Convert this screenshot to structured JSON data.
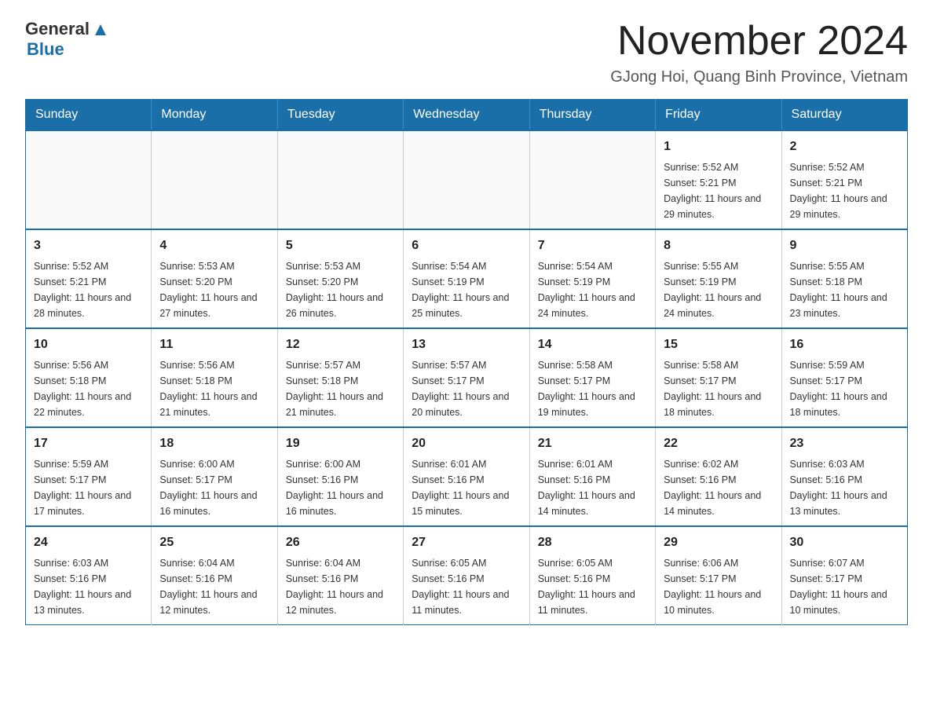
{
  "header": {
    "logo": {
      "general": "General",
      "triangle_alt": "triangle",
      "blue": "Blue"
    },
    "title": "November 2024",
    "subtitle": "GJong Hoi, Quang Binh Province, Vietnam"
  },
  "calendar": {
    "days_of_week": [
      "Sunday",
      "Monday",
      "Tuesday",
      "Wednesday",
      "Thursday",
      "Friday",
      "Saturday"
    ],
    "weeks": [
      [
        {
          "day": "",
          "sunrise": "",
          "sunset": "",
          "daylight": ""
        },
        {
          "day": "",
          "sunrise": "",
          "sunset": "",
          "daylight": ""
        },
        {
          "day": "",
          "sunrise": "",
          "sunset": "",
          "daylight": ""
        },
        {
          "day": "",
          "sunrise": "",
          "sunset": "",
          "daylight": ""
        },
        {
          "day": "",
          "sunrise": "",
          "sunset": "",
          "daylight": ""
        },
        {
          "day": "1",
          "sunrise": "Sunrise: 5:52 AM",
          "sunset": "Sunset: 5:21 PM",
          "daylight": "Daylight: 11 hours and 29 minutes."
        },
        {
          "day": "2",
          "sunrise": "Sunrise: 5:52 AM",
          "sunset": "Sunset: 5:21 PM",
          "daylight": "Daylight: 11 hours and 29 minutes."
        }
      ],
      [
        {
          "day": "3",
          "sunrise": "Sunrise: 5:52 AM",
          "sunset": "Sunset: 5:21 PM",
          "daylight": "Daylight: 11 hours and 28 minutes."
        },
        {
          "day": "4",
          "sunrise": "Sunrise: 5:53 AM",
          "sunset": "Sunset: 5:20 PM",
          "daylight": "Daylight: 11 hours and 27 minutes."
        },
        {
          "day": "5",
          "sunrise": "Sunrise: 5:53 AM",
          "sunset": "Sunset: 5:20 PM",
          "daylight": "Daylight: 11 hours and 26 minutes."
        },
        {
          "day": "6",
          "sunrise": "Sunrise: 5:54 AM",
          "sunset": "Sunset: 5:19 PM",
          "daylight": "Daylight: 11 hours and 25 minutes."
        },
        {
          "day": "7",
          "sunrise": "Sunrise: 5:54 AM",
          "sunset": "Sunset: 5:19 PM",
          "daylight": "Daylight: 11 hours and 24 minutes."
        },
        {
          "day": "8",
          "sunrise": "Sunrise: 5:55 AM",
          "sunset": "Sunset: 5:19 PM",
          "daylight": "Daylight: 11 hours and 24 minutes."
        },
        {
          "day": "9",
          "sunrise": "Sunrise: 5:55 AM",
          "sunset": "Sunset: 5:18 PM",
          "daylight": "Daylight: 11 hours and 23 minutes."
        }
      ],
      [
        {
          "day": "10",
          "sunrise": "Sunrise: 5:56 AM",
          "sunset": "Sunset: 5:18 PM",
          "daylight": "Daylight: 11 hours and 22 minutes."
        },
        {
          "day": "11",
          "sunrise": "Sunrise: 5:56 AM",
          "sunset": "Sunset: 5:18 PM",
          "daylight": "Daylight: 11 hours and 21 minutes."
        },
        {
          "day": "12",
          "sunrise": "Sunrise: 5:57 AM",
          "sunset": "Sunset: 5:18 PM",
          "daylight": "Daylight: 11 hours and 21 minutes."
        },
        {
          "day": "13",
          "sunrise": "Sunrise: 5:57 AM",
          "sunset": "Sunset: 5:17 PM",
          "daylight": "Daylight: 11 hours and 20 minutes."
        },
        {
          "day": "14",
          "sunrise": "Sunrise: 5:58 AM",
          "sunset": "Sunset: 5:17 PM",
          "daylight": "Daylight: 11 hours and 19 minutes."
        },
        {
          "day": "15",
          "sunrise": "Sunrise: 5:58 AM",
          "sunset": "Sunset: 5:17 PM",
          "daylight": "Daylight: 11 hours and 18 minutes."
        },
        {
          "day": "16",
          "sunrise": "Sunrise: 5:59 AM",
          "sunset": "Sunset: 5:17 PM",
          "daylight": "Daylight: 11 hours and 18 minutes."
        }
      ],
      [
        {
          "day": "17",
          "sunrise": "Sunrise: 5:59 AM",
          "sunset": "Sunset: 5:17 PM",
          "daylight": "Daylight: 11 hours and 17 minutes."
        },
        {
          "day": "18",
          "sunrise": "Sunrise: 6:00 AM",
          "sunset": "Sunset: 5:17 PM",
          "daylight": "Daylight: 11 hours and 16 minutes."
        },
        {
          "day": "19",
          "sunrise": "Sunrise: 6:00 AM",
          "sunset": "Sunset: 5:16 PM",
          "daylight": "Daylight: 11 hours and 16 minutes."
        },
        {
          "day": "20",
          "sunrise": "Sunrise: 6:01 AM",
          "sunset": "Sunset: 5:16 PM",
          "daylight": "Daylight: 11 hours and 15 minutes."
        },
        {
          "day": "21",
          "sunrise": "Sunrise: 6:01 AM",
          "sunset": "Sunset: 5:16 PM",
          "daylight": "Daylight: 11 hours and 14 minutes."
        },
        {
          "day": "22",
          "sunrise": "Sunrise: 6:02 AM",
          "sunset": "Sunset: 5:16 PM",
          "daylight": "Daylight: 11 hours and 14 minutes."
        },
        {
          "day": "23",
          "sunrise": "Sunrise: 6:03 AM",
          "sunset": "Sunset: 5:16 PM",
          "daylight": "Daylight: 11 hours and 13 minutes."
        }
      ],
      [
        {
          "day": "24",
          "sunrise": "Sunrise: 6:03 AM",
          "sunset": "Sunset: 5:16 PM",
          "daylight": "Daylight: 11 hours and 13 minutes."
        },
        {
          "day": "25",
          "sunrise": "Sunrise: 6:04 AM",
          "sunset": "Sunset: 5:16 PM",
          "daylight": "Daylight: 11 hours and 12 minutes."
        },
        {
          "day": "26",
          "sunrise": "Sunrise: 6:04 AM",
          "sunset": "Sunset: 5:16 PM",
          "daylight": "Daylight: 11 hours and 12 minutes."
        },
        {
          "day": "27",
          "sunrise": "Sunrise: 6:05 AM",
          "sunset": "Sunset: 5:16 PM",
          "daylight": "Daylight: 11 hours and 11 minutes."
        },
        {
          "day": "28",
          "sunrise": "Sunrise: 6:05 AM",
          "sunset": "Sunset: 5:16 PM",
          "daylight": "Daylight: 11 hours and 11 minutes."
        },
        {
          "day": "29",
          "sunrise": "Sunrise: 6:06 AM",
          "sunset": "Sunset: 5:17 PM",
          "daylight": "Daylight: 11 hours and 10 minutes."
        },
        {
          "day": "30",
          "sunrise": "Sunrise: 6:07 AM",
          "sunset": "Sunset: 5:17 PM",
          "daylight": "Daylight: 11 hours and 10 minutes."
        }
      ]
    ]
  }
}
